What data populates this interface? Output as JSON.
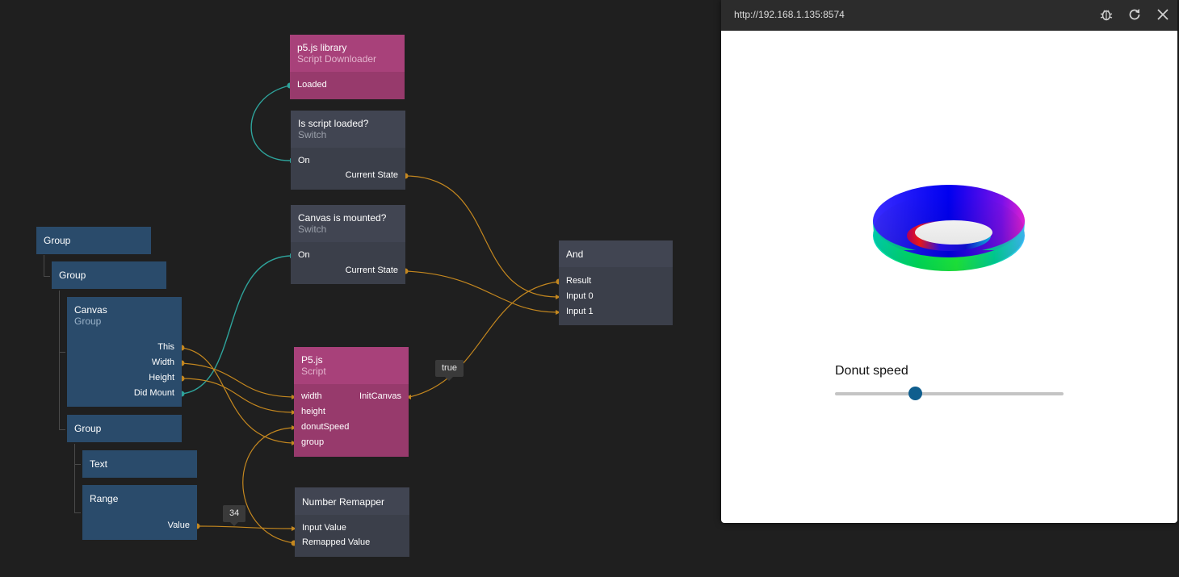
{
  "nodes": {
    "p5_library": {
      "title": "p5.js library",
      "subtitle": "Script Downloader",
      "ports": {
        "loaded": "Loaded"
      }
    },
    "is_script_loaded": {
      "title": "Is script loaded?",
      "subtitle": "Switch",
      "ports": {
        "on": "On",
        "current_state": "Current State"
      }
    },
    "canvas_is_mounted": {
      "title": "Canvas is mounted?",
      "subtitle": "Switch",
      "ports": {
        "on": "On",
        "current_state": "Current State"
      }
    },
    "and": {
      "title": "And",
      "ports": {
        "result": "Result",
        "input0": "Input 0",
        "input1": "Input 1"
      }
    },
    "group1": {
      "title": "Group"
    },
    "group2": {
      "title": "Group"
    },
    "canvas": {
      "title": "Canvas",
      "subtitle": "Group",
      "ports": {
        "this": "This",
        "width": "Width",
        "height": "Height",
        "did_mount": "Did Mount"
      }
    },
    "group3": {
      "title": "Group"
    },
    "text": {
      "title": "Text"
    },
    "range": {
      "title": "Range",
      "ports": {
        "value": "Value"
      }
    },
    "p5js": {
      "title": "P5.js",
      "subtitle": "Script",
      "ports": {
        "width": "width",
        "height": "height",
        "donut_speed": "donutSpeed",
        "group": "group",
        "init_canvas": "InitCanvas"
      }
    },
    "number_remapper": {
      "title": "Number Remapper",
      "ports": {
        "input_value": "Input Value",
        "remapped_value": "Remapped Value"
      }
    }
  },
  "bubbles": {
    "true_value": "true",
    "range_value": "34"
  },
  "preview": {
    "url": "http://192.168.1.135:8574",
    "buttons": {
      "debug": "bug-icon",
      "refresh": "refresh-icon",
      "close": "close-icon"
    },
    "slider_label": "Donut speed",
    "slider_fraction": 0.35
  },
  "colors": {
    "wire_signal": "#2ea39b",
    "wire_data": "#c4871f",
    "visual_node": "#2a4b6b",
    "logic_node": "#3b3f4a",
    "script_node": "#973a6c",
    "slider_thumb": "#0f5e8e"
  }
}
